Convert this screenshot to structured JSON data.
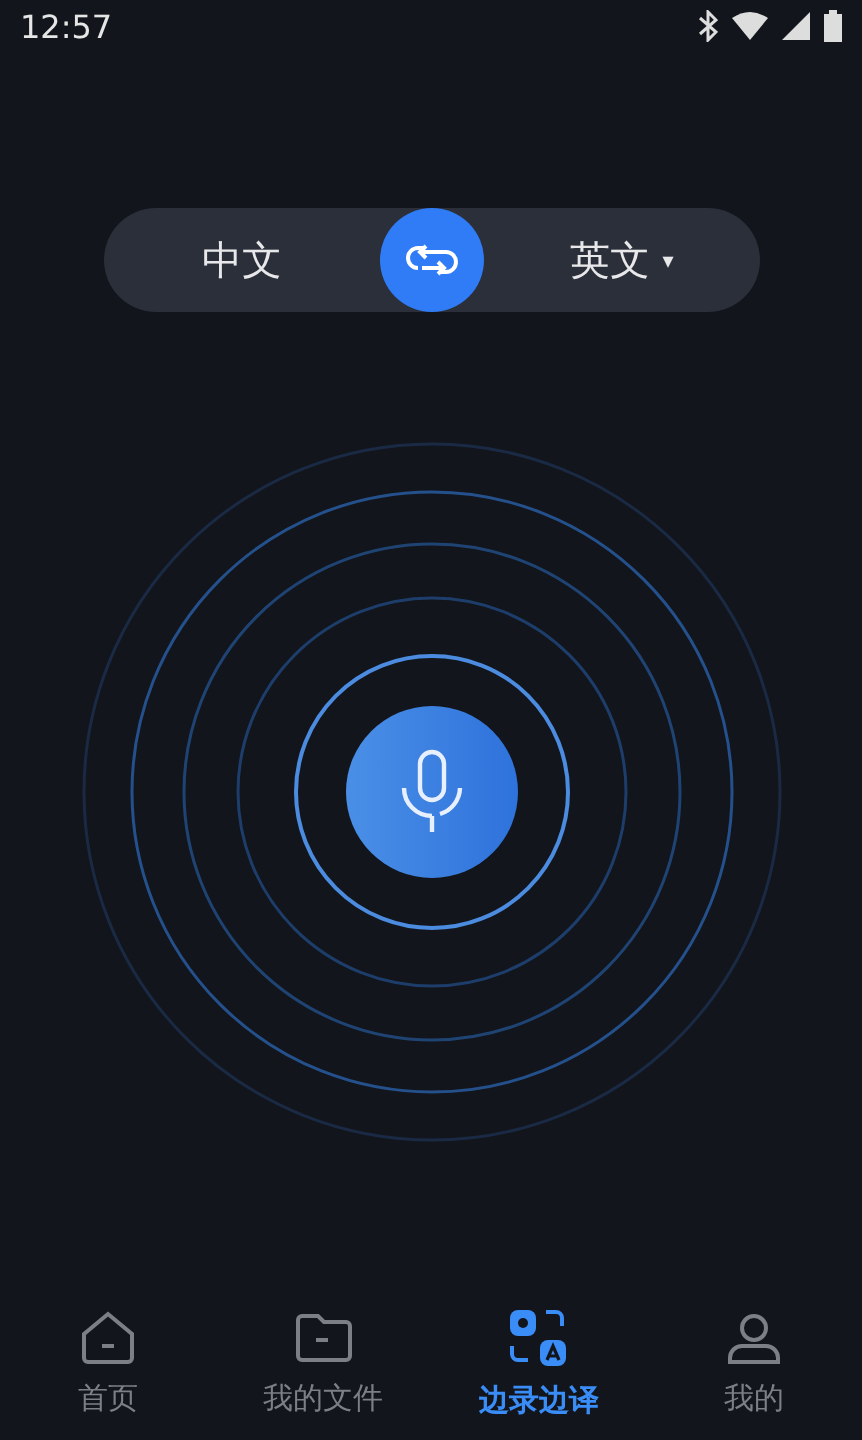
{
  "status_bar": {
    "time": "12:57"
  },
  "language_bar": {
    "source": "中文",
    "target": "英文",
    "target_caret": "▾"
  },
  "tabs": [
    {
      "label": "首页",
      "kind": "home",
      "selected": false
    },
    {
      "label": "我的文件",
      "kind": "files",
      "selected": false
    },
    {
      "label": "边录边译",
      "kind": "translate",
      "selected": true
    },
    {
      "label": "我的",
      "kind": "profile",
      "selected": false
    }
  ]
}
